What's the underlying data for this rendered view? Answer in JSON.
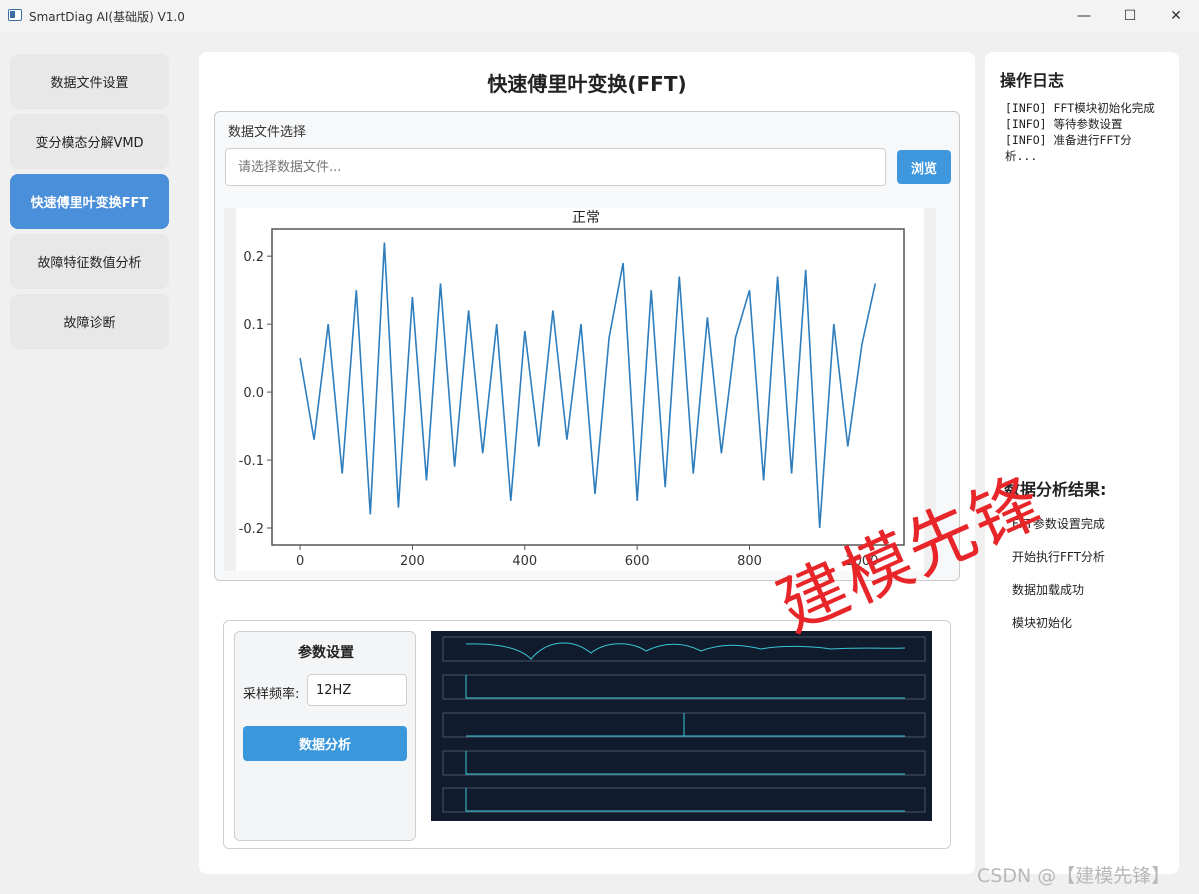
{
  "window": {
    "title": "SmartDiag AI(基础版) V1.0",
    "minimize": "—",
    "maximize": "☐",
    "close": "✕"
  },
  "nav": {
    "items": [
      {
        "label": "数据文件设置"
      },
      {
        "label": "变分模态分解VMD"
      },
      {
        "label": "快速傅里叶变换FFT"
      },
      {
        "label": "故障特征数值分析"
      },
      {
        "label": "故障诊断"
      }
    ],
    "active_index": 2
  },
  "main": {
    "title": "快速傅里叶变换(FFT)",
    "file_group_label": "数据文件选择",
    "file_input_placeholder": "请选择数据文件...",
    "browse_label": "浏览"
  },
  "chart_data": {
    "type": "line",
    "title": "正常",
    "xlabel": "",
    "ylabel": "",
    "xlim": [
      -50,
      1075
    ],
    "ylim": [
      -0.225,
      0.24
    ],
    "xticks": [
      0,
      200,
      400,
      600,
      800,
      1000
    ],
    "xtick_labels": [
      "0",
      "200",
      "400",
      "600",
      "800",
      "1000"
    ],
    "yticks": [
      0.2,
      0.1,
      0.0,
      -0.1,
      -0.2
    ],
    "ytick_labels": [
      "0.2",
      "0.1",
      "0.0",
      "-0.1",
      "-0.2"
    ],
    "grid": false,
    "color": "#2e7dbd",
    "x": [
      0,
      25,
      50,
      75,
      100,
      125,
      150,
      175,
      200,
      225,
      250,
      275,
      300,
      325,
      350,
      375,
      400,
      425,
      450,
      475,
      500,
      525,
      550,
      575,
      600,
      625,
      650,
      675,
      700,
      725,
      750,
      775,
      800,
      825,
      850,
      875,
      900,
      925,
      950,
      975,
      1000,
      1024
    ],
    "values": [
      0.05,
      -0.07,
      0.1,
      -0.12,
      0.15,
      -0.18,
      0.22,
      -0.17,
      0.14,
      -0.13,
      0.16,
      -0.11,
      0.12,
      -0.09,
      0.1,
      -0.16,
      0.09,
      -0.08,
      0.12,
      -0.07,
      0.1,
      -0.15,
      0.08,
      0.19,
      -0.16,
      0.15,
      -0.14,
      0.17,
      -0.12,
      0.11,
      -0.09,
      0.08,
      0.15,
      -0.13,
      0.17,
      -0.12,
      0.18,
      -0.2,
      0.1,
      -0.08,
      0.07,
      0.16
    ]
  },
  "params": {
    "title": "参数设置",
    "rate_label": "采样频率:",
    "rate_value": "12HZ",
    "analyze_label": "数据分析"
  },
  "log": {
    "title": "操作日志",
    "lines": [
      "[INFO] FFT模块初始化完成",
      "[INFO] 等待参数设置",
      "[INFO] 准备进行FFT分",
      "析..."
    ]
  },
  "results": {
    "title": "数据分析结果:",
    "items": [
      "FFT参数设置完成",
      "开始执行FFT分析",
      "数据加载成功",
      "模块初始化"
    ]
  },
  "watermark": "建模先锋",
  "csdn_mark": "CSDN @【建模先锋】",
  "colors": {
    "accent": "#3f97de",
    "nav_active": "#4a8fd9",
    "watermark": "#e8262a",
    "dark_plot_bg": "#101c2e",
    "dark_plot_line": "#39c6d6"
  }
}
